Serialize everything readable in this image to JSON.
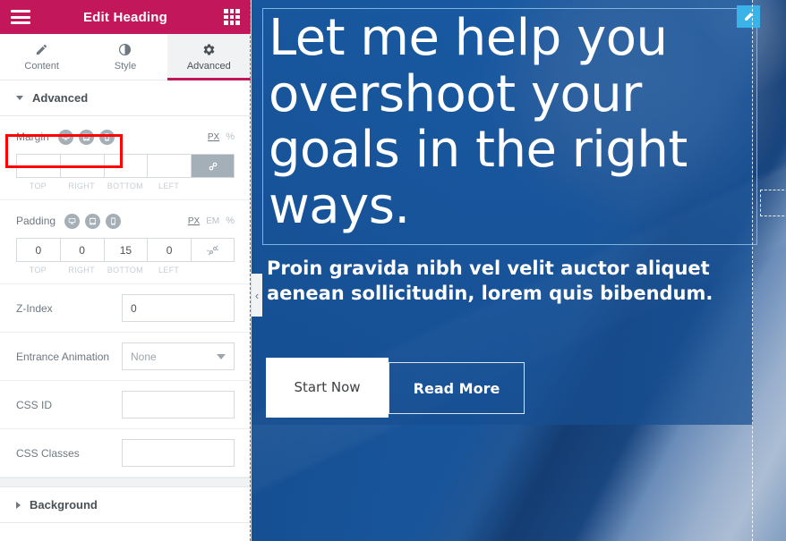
{
  "panel": {
    "header": {
      "title": "Edit Heading",
      "menu_icon": "hamburger-icon",
      "grid_icon": "grid-icon"
    },
    "tabs": [
      {
        "label": "Content",
        "icon": "pencil-icon",
        "active": false
      },
      {
        "label": "Style",
        "icon": "contrast-icon",
        "active": false
      },
      {
        "label": "Advanced",
        "icon": "gear-icon",
        "active": true
      }
    ],
    "sections": {
      "advanced": {
        "title": "Advanced",
        "expanded": true
      },
      "background": {
        "title": "Background",
        "expanded": false
      }
    },
    "margin": {
      "label": "Margin",
      "devices": [
        "desktop-icon",
        "tablet-icon",
        "mobile-icon"
      ],
      "units": [
        "PX",
        "%"
      ],
      "active_unit": "PX",
      "values": [
        "",
        "",
        "",
        ""
      ],
      "captions": [
        "TOP",
        "RIGHT",
        "BOTTOM",
        "LEFT"
      ],
      "linked": true,
      "link_icon": "link-icon"
    },
    "padding": {
      "label": "Padding",
      "devices": [
        "desktop-icon",
        "tablet-icon",
        "mobile-icon"
      ],
      "units": [
        "PX",
        "EM",
        "%"
      ],
      "active_unit": "PX",
      "values": [
        "0",
        "0",
        "15",
        "0"
      ],
      "captions": [
        "TOP",
        "RIGHT",
        "BOTTOM",
        "LEFT"
      ],
      "linked": false,
      "link_icon": "unlink-icon"
    },
    "fields": {
      "z_index": {
        "label": "Z-Index",
        "value": "0",
        "placeholder": ""
      },
      "entrance_animation": {
        "label": "Entrance Animation",
        "value": "None",
        "caret": "chevron-down-icon"
      },
      "css_id": {
        "label": "CSS ID",
        "value": "",
        "placeholder": ""
      },
      "css_classes": {
        "label": "CSS Classes",
        "value": "",
        "placeholder": ""
      }
    },
    "highlight_color": "#ff0000"
  },
  "canvas": {
    "heading": "Let me help you overshoot your goals in the right ways.",
    "edit_badge_icon": "pencil-edit-icon",
    "subtitle": "Proin gravida nibh vel velit auctor aliquet aenean sollicitudin, lorem quis bibendum.",
    "buttons": {
      "primary": "Start Now",
      "secondary": "Read More"
    },
    "collapse_arrow": "‹",
    "accent_color": "#39b3e8",
    "background_color": "#1b5ca6"
  }
}
